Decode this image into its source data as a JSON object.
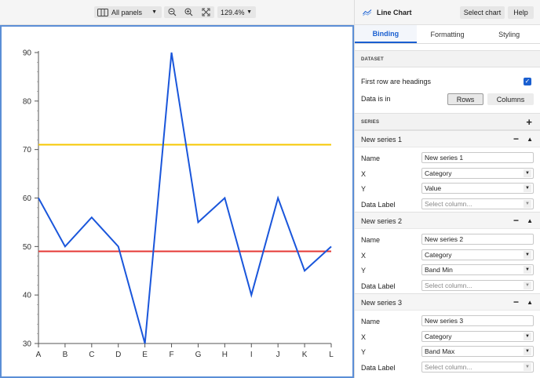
{
  "toolbar": {
    "panels_label": "All panels",
    "zoom_value": "129.4%"
  },
  "panel": {
    "title": "Line Chart",
    "select_chart": "Select chart",
    "help": "Help",
    "tabs": [
      "Binding",
      "Formatting",
      "Styling"
    ],
    "dataset_heading": "DATASET",
    "first_row_headings": "First row are headings",
    "data_is_in": "Data is in",
    "rows_label": "Rows",
    "columns_label": "Columns",
    "series_heading": "SERIES",
    "field_labels": {
      "name": "Name",
      "x": "X",
      "y": "Y",
      "data_label": "Data Label"
    },
    "series": [
      {
        "title": "New series 1",
        "name": "New series 1",
        "x": "Category",
        "y": "Value",
        "data_label": "Select column..."
      },
      {
        "title": "New series 2",
        "name": "New series 2",
        "x": "Category",
        "y": "Band Min",
        "data_label": "Select column..."
      },
      {
        "title": "New series 3",
        "name": "New series 3",
        "x": "Category",
        "y": "Band Max",
        "data_label": "Select column..."
      }
    ]
  },
  "colors": {
    "value_line": "#1a56db",
    "band_min_line": "#e53935",
    "band_max_line": "#f6c700",
    "accent": "#1a5fd0"
  },
  "chart_data": {
    "type": "line",
    "categories": [
      "A",
      "B",
      "C",
      "D",
      "E",
      "F",
      "G",
      "H",
      "I",
      "J",
      "K",
      "L"
    ],
    "ylim": [
      30,
      90
    ],
    "yticks": [
      30,
      40,
      50,
      60,
      70,
      80,
      90
    ],
    "series": [
      {
        "values": [
          60,
          50,
          56,
          50,
          30,
          90,
          55,
          60,
          40,
          60,
          45,
          50
        ]
      },
      {
        "values": [
          49,
          49,
          49,
          49,
          49,
          49,
          49,
          49,
          49,
          49,
          49,
          49
        ]
      },
      {
        "values": [
          71,
          71,
          71,
          71,
          71,
          71,
          71,
          71,
          71,
          71,
          71,
          71
        ]
      }
    ]
  }
}
